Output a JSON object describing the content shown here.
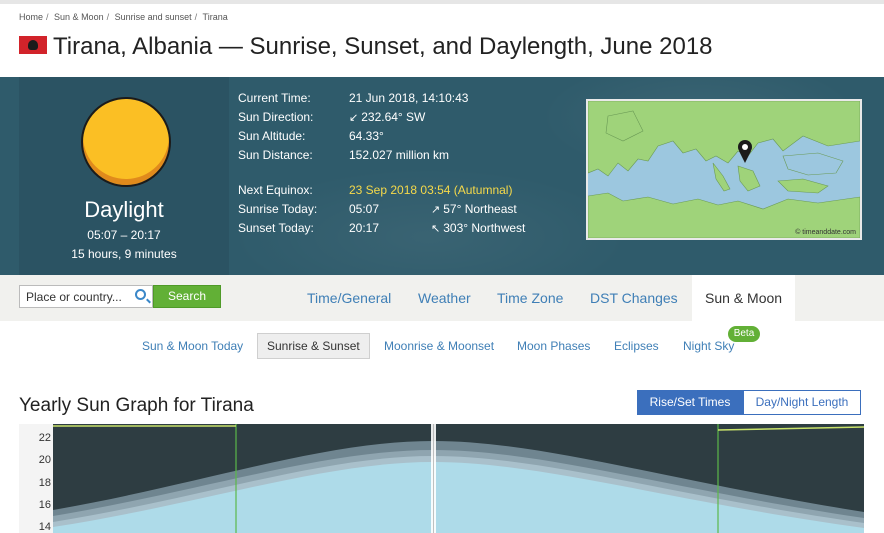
{
  "breadcrumbs": [
    "Home",
    "Sun & Moon",
    "Sunrise and sunset",
    "Tirana"
  ],
  "title": "Tirana, Albania — Sunrise, Sunset, and Daylength, June 2018",
  "sun_panel": {
    "label": "Daylight",
    "times": "05:07 – 20:17",
    "length": "15 hours, 9 minutes"
  },
  "info": {
    "current_time_label": "Current Time:",
    "current_time": "21 Jun 2018, 14:10:43",
    "direction_label": "Sun Direction:",
    "direction": "232.64° SW",
    "altitude_label": "Sun Altitude:",
    "altitude": "64.33°",
    "distance_label": "Sun Distance:",
    "distance": "152.027 million km",
    "equinox_label": "Next Equinox:",
    "equinox": "23 Sep 2018 03:54 (Autumnal)",
    "sunrise_label": "Sunrise Today:",
    "sunrise": "05:07",
    "sunrise_dir": "57° Northeast",
    "sunset_label": "Sunset Today:",
    "sunset": "20:17",
    "sunset_dir": "303° Northwest"
  },
  "map_credit": "© timeanddate.com",
  "search": {
    "placeholder": "Place or country...",
    "button": "Search"
  },
  "main_tabs": [
    "Time/General",
    "Weather",
    "Time Zone",
    "DST Changes",
    "Sun & Moon"
  ],
  "sub_tabs": [
    "Sun & Moon Today",
    "Sunrise & Sunset",
    "Moonrise & Moonset",
    "Moon Phases",
    "Eclipses",
    "Night Sky"
  ],
  "beta": "Beta",
  "graph": {
    "title": "Yearly Sun Graph for Tirana",
    "btn_active": "Rise/Set Times",
    "btn_other": "Day/Night Length",
    "yticks": [
      "22",
      "20",
      "18",
      "16",
      "14"
    ]
  },
  "colors": {
    "accent": "#3b6fbd",
    "hero": "#2f5b6b",
    "green": "#62b036",
    "sun": "#fbbf24"
  }
}
